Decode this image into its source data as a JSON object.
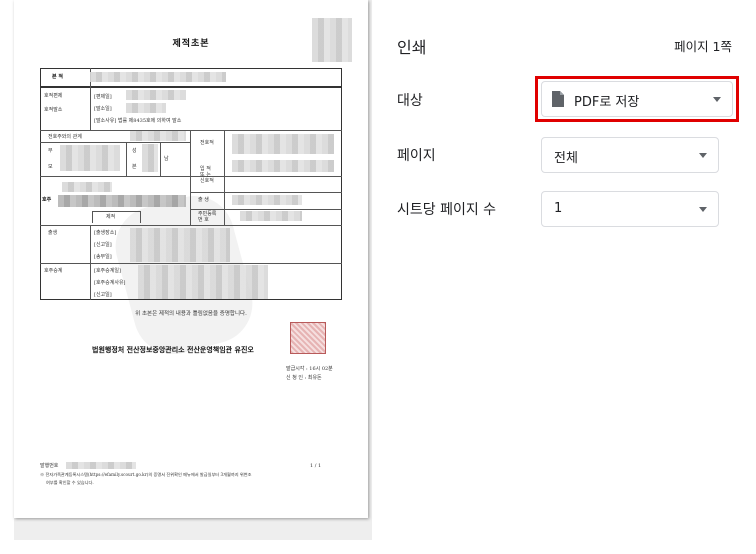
{
  "preview": {
    "doc_title": "제적초본",
    "row_labels": {
      "main": "본 적",
      "register_edit": "호적편제",
      "register_delete": "호적말소",
      "relation": "전호주와의 관계",
      "father": "부",
      "mother": "모",
      "surname": "성",
      "origin": "본",
      "sex": "남",
      "prev_head": "전호적",
      "join": "입 적\n또 는\n신호적",
      "head": "호주",
      "birth": "출 생",
      "resident_no": "주민등록\n번 호",
      "removed": "제적",
      "birth_section": "출생",
      "succession": "호주승계"
    },
    "bracket_fields": {
      "edit_date": "[편제일]",
      "delete_date": "[말소일]",
      "delete_reason": "[말소사유] 법률 제8435호에 의하여 말소",
      "birth_place": "[출생장소]",
      "report_date": "[신고일]",
      "send_date": "[송부일]",
      "succession_date": "[호주승계일]",
      "succession_reason": "[호주승계사유]",
      "report_date2": "[신고일]"
    },
    "statement": "위 초본은 제적의 내용과 틀림없음을 증명합니다.",
    "issuer": "법원행정처 전산정보중앙관리소 전산운영책임관 유진오",
    "issue_time": "발급시각 : 16시 02분",
    "issuer_person": "신 청 인 : 최유돈",
    "issue_no": "발행번호",
    "page_indicator": "1 / 1",
    "footnote_1": "※ 전자가족관계등록시스템(https://efamily.scourt.go.kr)의 증명서 진위확인 메뉴에서 발급일부터 3개월까지 위변조",
    "footnote_2": "여부를 확인할 수 있습니다."
  },
  "settings": {
    "title": "인쇄",
    "page_count": "페이지 1쪽",
    "destination": {
      "label": "대상",
      "value": "PDF로 저장",
      "icon": "document-icon"
    },
    "pages": {
      "label": "페이지",
      "value": "전체"
    },
    "pages_per_sheet": {
      "label": "시트당 페이지 수",
      "value": "1"
    }
  },
  "colors": {
    "highlight": "#e00000",
    "text": "#202124",
    "border": "#dadce0",
    "preview_bg": "#eeeeee"
  }
}
